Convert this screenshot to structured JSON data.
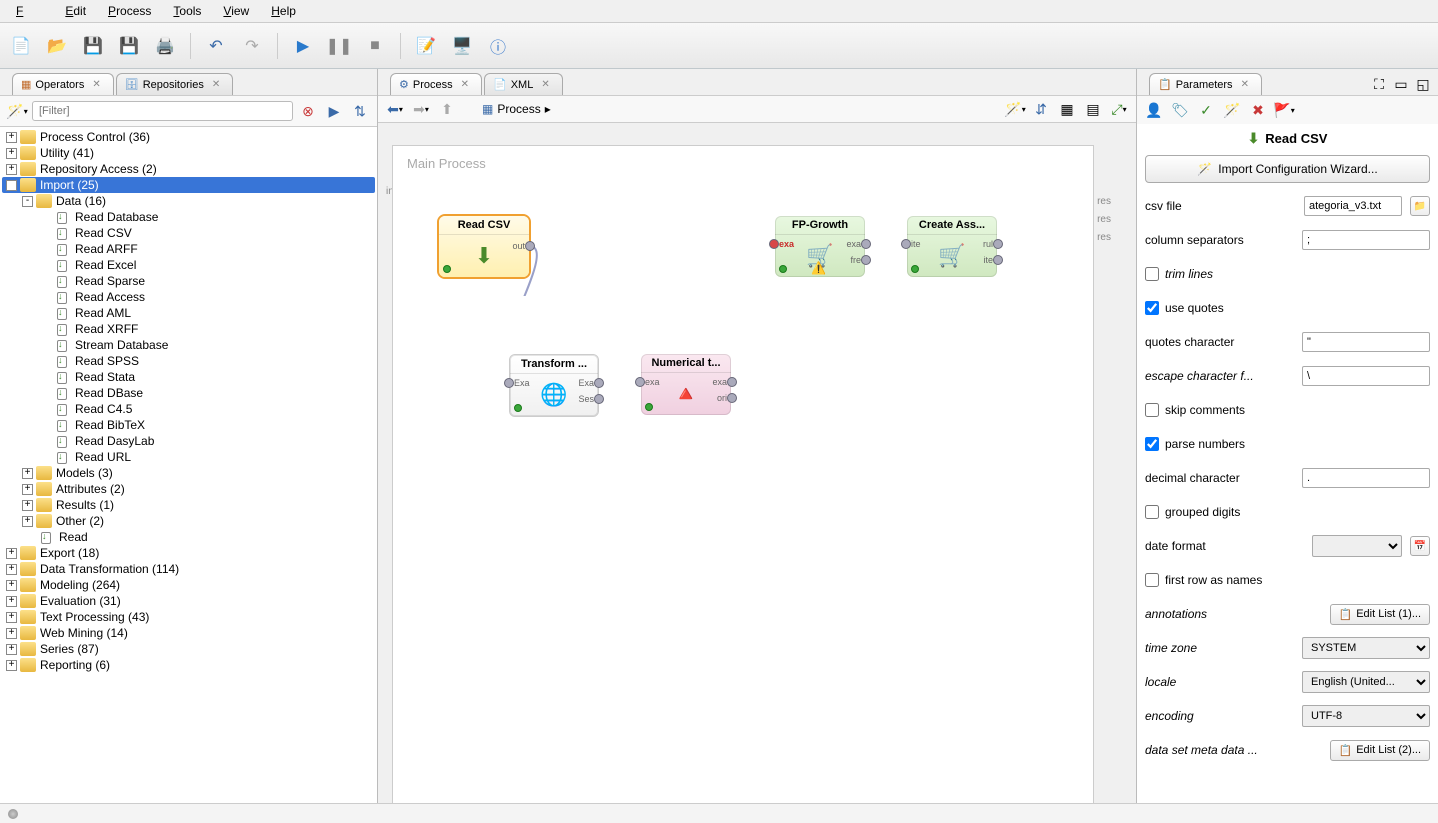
{
  "menu": {
    "file": "File",
    "edit": "Edit",
    "process": "Process",
    "tools": "Tools",
    "view": "View",
    "help": "Help"
  },
  "toolbar": {
    "new": "new-file-icon",
    "open": "open-folder-icon",
    "save": "save-icon",
    "saveAll": "save-all-icon",
    "print": "print-icon",
    "undo": "undo-icon",
    "redo": "redo-icon",
    "run": "play-icon",
    "pause": "pause-icon",
    "stop": "stop-icon",
    "notes": "notes-icon",
    "presentation": "presentation-icon",
    "info": "info-icon"
  },
  "leftTabs": {
    "operators": "Operators",
    "repositories": "Repositories"
  },
  "filter": {
    "placeholder": "[Filter]"
  },
  "tree": {
    "nodes": [
      {
        "level": 0,
        "toggle": "+",
        "icon": "folder",
        "label": "Process Control (36)"
      },
      {
        "level": 0,
        "toggle": "+",
        "icon": "folder",
        "label": "Utility (41)"
      },
      {
        "level": 0,
        "toggle": "+",
        "icon": "folder",
        "label": "Repository Access (2)"
      },
      {
        "level": 0,
        "toggle": "-",
        "icon": "folder",
        "label": "Import (25)",
        "selected": true
      },
      {
        "level": 1,
        "toggle": "-",
        "icon": "folder",
        "label": "Data (16)"
      },
      {
        "level": 2,
        "toggle": "",
        "icon": "leaf",
        "label": "Read Database"
      },
      {
        "level": 2,
        "toggle": "",
        "icon": "leaf",
        "label": "Read CSV"
      },
      {
        "level": 2,
        "toggle": "",
        "icon": "leaf",
        "label": "Read ARFF"
      },
      {
        "level": 2,
        "toggle": "",
        "icon": "leaf",
        "label": "Read Excel"
      },
      {
        "level": 2,
        "toggle": "",
        "icon": "leaf",
        "label": "Read Sparse"
      },
      {
        "level": 2,
        "toggle": "",
        "icon": "leaf",
        "label": "Read Access"
      },
      {
        "level": 2,
        "toggle": "",
        "icon": "leaf",
        "label": "Read AML"
      },
      {
        "level": 2,
        "toggle": "",
        "icon": "leaf",
        "label": "Read XRFF"
      },
      {
        "level": 2,
        "toggle": "",
        "icon": "leaf",
        "label": "Stream Database"
      },
      {
        "level": 2,
        "toggle": "",
        "icon": "leaf",
        "label": "Read SPSS"
      },
      {
        "level": 2,
        "toggle": "",
        "icon": "leaf",
        "label": "Read Stata"
      },
      {
        "level": 2,
        "toggle": "",
        "icon": "leaf",
        "label": "Read DBase"
      },
      {
        "level": 2,
        "toggle": "",
        "icon": "leaf",
        "label": "Read C4.5"
      },
      {
        "level": 2,
        "toggle": "",
        "icon": "leaf",
        "label": "Read BibTeX"
      },
      {
        "level": 2,
        "toggle": "",
        "icon": "leaf",
        "label": "Read DasyLab"
      },
      {
        "level": 2,
        "toggle": "",
        "icon": "leaf",
        "label": "Read URL"
      },
      {
        "level": 1,
        "toggle": "+",
        "icon": "folder",
        "label": "Models (3)"
      },
      {
        "level": 1,
        "toggle": "+",
        "icon": "folder",
        "label": "Attributes (2)"
      },
      {
        "level": 1,
        "toggle": "+",
        "icon": "folder",
        "label": "Results (1)"
      },
      {
        "level": 1,
        "toggle": "+",
        "icon": "folder",
        "label": "Other (2)"
      },
      {
        "level": 1,
        "toggle": "",
        "icon": "leaf",
        "label": "Read"
      },
      {
        "level": 0,
        "toggle": "+",
        "icon": "folder",
        "label": "Export (18)"
      },
      {
        "level": 0,
        "toggle": "+",
        "icon": "folder",
        "label": "Data Transformation (114)"
      },
      {
        "level": 0,
        "toggle": "+",
        "icon": "folder",
        "label": "Modeling (264)"
      },
      {
        "level": 0,
        "toggle": "+",
        "icon": "folder",
        "label": "Evaluation (31)"
      },
      {
        "level": 0,
        "toggle": "+",
        "icon": "folder",
        "label": "Text Processing (43)"
      },
      {
        "level": 0,
        "toggle": "+",
        "icon": "folder",
        "label": "Web Mining (14)"
      },
      {
        "level": 0,
        "toggle": "+",
        "icon": "folder",
        "label": "Series (87)"
      },
      {
        "level": 0,
        "toggle": "+",
        "icon": "folder",
        "label": "Reporting (6)"
      }
    ]
  },
  "centerTabs": {
    "process": "Process",
    "xml": "XML"
  },
  "crumb": {
    "label": "Process",
    "arrow": "▸"
  },
  "canvas": {
    "title": "Main Process",
    "inp": "inp",
    "res": "res",
    "ops": {
      "readcsv": {
        "title": "Read CSV",
        "out": "out"
      },
      "transform": {
        "title": "Transform ...",
        "exaIn": "Exa",
        "exaOut": "Exa",
        "ses": "Ses"
      },
      "numerical": {
        "title": "Numerical t...",
        "exaIn": "exa",
        "exaOut": "exa",
        "ori": "ori"
      },
      "fpgrowth": {
        "title": "FP-Growth",
        "exaIn": "exa",
        "exaOut": "exa",
        "fre": "fre"
      },
      "createass": {
        "title": "Create Ass...",
        "ite": "ite",
        "rul": "rul",
        "ite2": "ite"
      }
    }
  },
  "paramsPanel": {
    "title": "Parameters",
    "opTitle": "Read CSV",
    "wizard": "Import Configuration Wizard..."
  },
  "params": {
    "csvfile": {
      "label": "csv file",
      "value": "ategoria_v3.txt"
    },
    "colsep": {
      "label": "column separators",
      "value": ";"
    },
    "trim": {
      "label": "trim lines",
      "checked": false
    },
    "quotes": {
      "label": "use quotes",
      "checked": true
    },
    "quotechar": {
      "label": "quotes character",
      "value": "\""
    },
    "escape": {
      "label": "escape character f...",
      "value": "\\"
    },
    "skipcom": {
      "label": "skip comments",
      "checked": false
    },
    "parsenum": {
      "label": "parse numbers",
      "checked": true
    },
    "decimal": {
      "label": "decimal character",
      "value": "."
    },
    "grouped": {
      "label": "grouped digits",
      "checked": false
    },
    "dateformat": {
      "label": "date format",
      "value": ""
    },
    "firstrow": {
      "label": "first row as names",
      "checked": false
    },
    "annotations": {
      "label": "annotations",
      "button": "Edit List (1)..."
    },
    "timezone": {
      "label": "time zone",
      "value": "SYSTEM"
    },
    "locale": {
      "label": "locale",
      "value": "English (United..."
    },
    "encoding": {
      "label": "encoding",
      "value": "UTF-8"
    },
    "metadata": {
      "label": "data set meta data ...",
      "button": "Edit List (2)..."
    }
  }
}
